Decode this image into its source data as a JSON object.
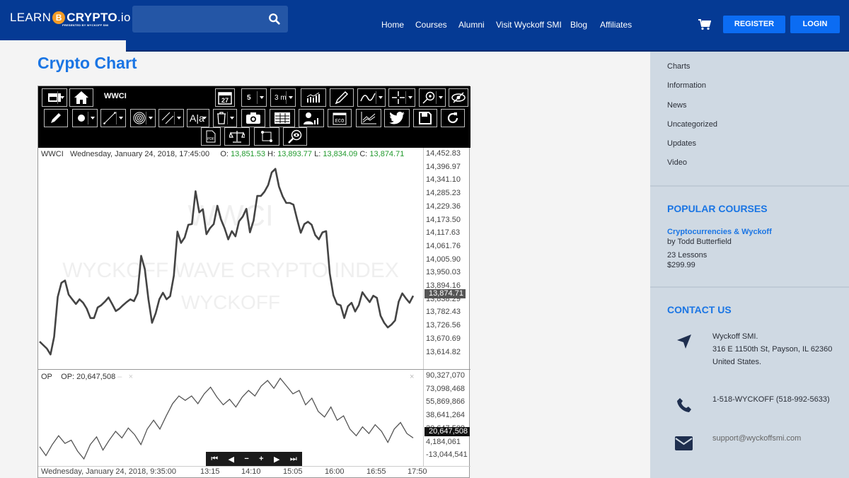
{
  "header": {
    "logo_learn": "LEARN",
    "logo_coin": "B",
    "logo_crypto": "CRYPTO",
    "logo_tld": ".io",
    "logo_sub": "PRESENTED BY WYCKOFF SMI",
    "search_placeholder": "",
    "nav": [
      "Home",
      "Courses",
      "Alumni",
      "Visit Wyckoff SMI",
      "Blog",
      "Affiliates"
    ],
    "register": "REGISTER",
    "login": "LOGIN"
  },
  "page_title": "Crypto Chart",
  "chart_widget": {
    "symbol": "WWCI",
    "calendar_day": "27",
    "periods": "5",
    "interval": "3 m",
    "toolbar_buttons": [
      "layout",
      "home",
      "calendar",
      "periods",
      "interval",
      "chart-type",
      "paint",
      "studies",
      "crosshair",
      "zoom",
      "hide",
      "pencil",
      "marker",
      "line",
      "fibonacci",
      "channel",
      "text",
      "trash",
      "camera",
      "table",
      "profile",
      "economic-calendar",
      "compare",
      "twitter",
      "save",
      "refresh",
      "pdf",
      "scale",
      "transform",
      "search-eye"
    ],
    "legend": {
      "symbol": "WWCI",
      "date": "Wednesday, January 24, 2018, 17:45:00",
      "o_label": "O:",
      "o": "13,851.53",
      "h_label": "H:",
      "h": "13,893.77",
      "l_label": "L:",
      "l": "13,834.09",
      "c_label": "C:",
      "c": "13,874.71"
    },
    "watermark": {
      "line1": "WWCI",
      "line2": "WYCKOFF WAVE CRYPTO INDEX",
      "line3": "WYCKOFF"
    },
    "price_axis": [
      "14,452.83",
      "14,396.97",
      "14,341.10",
      "14,285.23",
      "14,229.36",
      "14,173.50",
      "14,117.63",
      "14,061.76",
      "14,005.90",
      "13,950.03",
      "13,894.16",
      "13,838.29",
      "13,782.43",
      "13,726.56",
      "13,670.69",
      "13,614.82"
    ],
    "price_tag": "13,874.71",
    "op_legend": {
      "name": "OP",
      "value": "OP: 20,647,508",
      "minus": "–",
      "close": "×"
    },
    "op_close": "×",
    "op_axis": [
      "90,327,070",
      "73,098,468",
      "55,869,866",
      "38,641,264",
      "20,647,508",
      "4,184,061",
      "-13,044,541"
    ],
    "op_tag": "20,647,508",
    "nav_buttons": [
      "⏮",
      "◀",
      "−",
      "+",
      "▶",
      "⏭"
    ],
    "x_axis": [
      "Wednesday, January 24, 2018, 9:35:00",
      "13:15",
      "14:10",
      "15:05",
      "16:00",
      "16:55",
      "17:50"
    ]
  },
  "chart_data": [
    {
      "type": "line",
      "title": "WWCI",
      "ylim": [
        13586.89,
        14480.76
      ],
      "y_ticks": [
        14452.83,
        14396.97,
        14341.1,
        14285.23,
        14229.36,
        14173.5,
        14117.63,
        14061.76,
        14005.9,
        13950.03,
        13894.16,
        13838.29,
        13782.43,
        13726.56,
        13670.69,
        13614.82
      ],
      "x_ticks": [
        "9:35",
        "13:15",
        "14:10",
        "15:05",
        "16:00",
        "16:55",
        "17:50"
      ],
      "values": [
        13680,
        13665,
        13650,
        13625,
        13700,
        13870,
        13930,
        13940,
        13880,
        13860,
        13840,
        13860,
        13845,
        13820,
        13780,
        13780,
        13825,
        13835,
        13850,
        13868,
        13840,
        13810,
        13820,
        13835,
        13848,
        13860,
        13852,
        13885,
        14045,
        13988,
        13860,
        13760,
        13800,
        13860,
        13888,
        13860,
        13873,
        13960,
        14148,
        14100,
        14123,
        14177,
        14180,
        14320,
        14230,
        14243,
        14137,
        14163,
        14180,
        14258,
        14200,
        14163,
        14115,
        14150,
        14128,
        14192,
        14212,
        14245,
        14145,
        14195,
        14300,
        14300,
        14318,
        14346,
        14400,
        14415,
        14340,
        14298,
        14270,
        14270,
        14263,
        14200,
        14143,
        14180,
        14190,
        14177,
        14133,
        14115,
        14145,
        14150,
        13970,
        13877,
        13840,
        13834,
        13780,
        13830,
        13845,
        13808,
        13835,
        13890,
        13868,
        13848,
        13875,
        13866,
        13790,
        13760,
        13740,
        13752,
        13770,
        13850,
        13885,
        13864,
        13845,
        13875
      ],
      "last": 13874.71,
      "series_name": "WWCI"
    },
    {
      "type": "line",
      "title": "OP",
      "ylim": [
        -21658842,
        98941371
      ],
      "y_ticks": [
        90327070,
        73098468,
        55869866,
        38641264,
        20647508,
        4184061,
        -13044541
      ],
      "values": [
        0,
        -8,
        2,
        10,
        3,
        6,
        -4,
        -11,
        2,
        9,
        -3,
        6,
        14,
        8,
        17,
        11,
        2,
        16,
        24,
        16,
        28,
        39,
        46,
        42,
        46,
        39,
        48,
        54,
        45,
        38,
        43,
        36,
        45,
        51,
        46,
        55,
        60,
        53,
        62,
        55,
        48,
        51,
        38,
        44,
        32,
        27,
        36,
        24,
        28,
        16,
        10,
        18,
        12,
        20,
        14,
        4,
        16,
        22,
        12,
        8
      ],
      "last": 20647508,
      "series_name": "OP"
    }
  ],
  "sidebar": {
    "categories": [
      "Charts",
      "Information",
      "News",
      "Uncategorized",
      "Updates",
      "Video"
    ],
    "popular_title": "POPULAR COURSES",
    "course_title": "Cryptocurrencies & Wyckoff",
    "course_author": "by Todd Butterfield",
    "course_lessons": "23 Lessons",
    "course_price": "$299.99",
    "contact_title": "CONTACT US",
    "address": [
      "Wyckoff SMI.",
      "316 E 1150th St, Payson, IL 62360",
      "United States."
    ],
    "phone": "1-518-WYCKOFF (518-992-5633)",
    "email": "support@wyckoffsmi.com"
  },
  "colors": {
    "header": "#053a94",
    "accent": "#1a75e4",
    "button": "#0b6cf3",
    "sidebar": "#cfd9e3",
    "positive": "#229a2e"
  }
}
